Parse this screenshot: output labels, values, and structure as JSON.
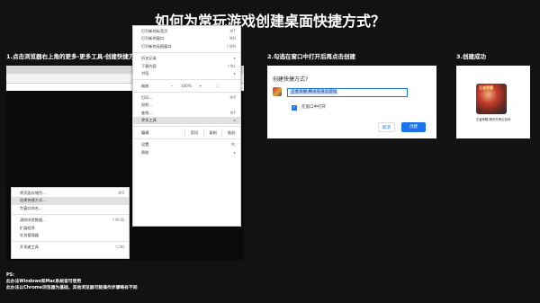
{
  "title": "如何为常玩游戏创建桌面快捷方式？",
  "steps": [
    "1.点击浏览器右上角的更多-更多工具-创建快捷方式",
    "2.勾选在窗口中打开后再点击创建",
    "3.创建成功"
  ],
  "toolbar_icons": [
    "new-tab-icon",
    "search-icon",
    "share-icon",
    "bookmark-star-icon",
    "extension-icon",
    "profile-icon",
    "puzzle-icon",
    "more-menu-icon"
  ],
  "main_menu": {
    "items": [
      {
        "label": "打开新的标签页",
        "shortcut": "⌘T"
      },
      {
        "label": "打开新的窗口",
        "shortcut": "⌘N"
      },
      {
        "label": "打开新的无痕窗口",
        "shortcut": "⇧⌘N"
      },
      {
        "label": "历史记录",
        "shortcut": "▸"
      },
      {
        "label": "下载内容",
        "shortcut": "⇧⌘L"
      },
      {
        "label": "书签",
        "shortcut": "▸"
      },
      {
        "label": "缩放",
        "zoom": "100%"
      },
      {
        "label": "打印...",
        "shortcut": "⌘P"
      },
      {
        "label": "投射...",
        "shortcut": ""
      },
      {
        "label": "查找...",
        "shortcut": "⌘F"
      },
      {
        "label": "更多工具",
        "shortcut": "▸"
      },
      {
        "label": "编辑",
        "edit_buttons": [
          "剪切",
          "复制",
          "粘贴"
        ]
      },
      {
        "label": "设置",
        "shortcut": "⌘,"
      },
      {
        "label": "帮助",
        "shortcut": "▸"
      }
    ]
  },
  "submenu": {
    "items": [
      {
        "label": "将页面存储为...",
        "shortcut": "⌘S"
      },
      {
        "label": "创建快捷方式...",
        "shortcut": ""
      },
      {
        "label": "为窗口命名...",
        "shortcut": ""
      },
      {
        "label": "清除浏览数据...",
        "shortcut": "⇧⌘⌫"
      },
      {
        "label": "扩展程序",
        "shortcut": ""
      },
      {
        "label": "任务管理器",
        "shortcut": ""
      },
      {
        "label": "开发者工具",
        "shortcut": "⌥⌘I"
      }
    ]
  },
  "dialog": {
    "title": "创建快捷方式?",
    "name_value": "王者荣耀-腾讯先锋云游戏",
    "checkbox_label": "在窗口中打开",
    "checkbox_checked": true,
    "cancel_label": "取消",
    "create_label": "创建"
  },
  "desktop_icon": {
    "logo_text": "王者荣耀",
    "caption": "王者荣耀-腾讯先锋云游戏"
  },
  "ps": {
    "label": "PS:",
    "lines": [
      "此办法Windows和Mac系统皆可使用",
      "此办法以Chrome浏览器为基础，其他浏览器可能操作步骤略有不同"
    ]
  },
  "colors": {
    "accent": "#1a73e8",
    "background": "#121212"
  }
}
